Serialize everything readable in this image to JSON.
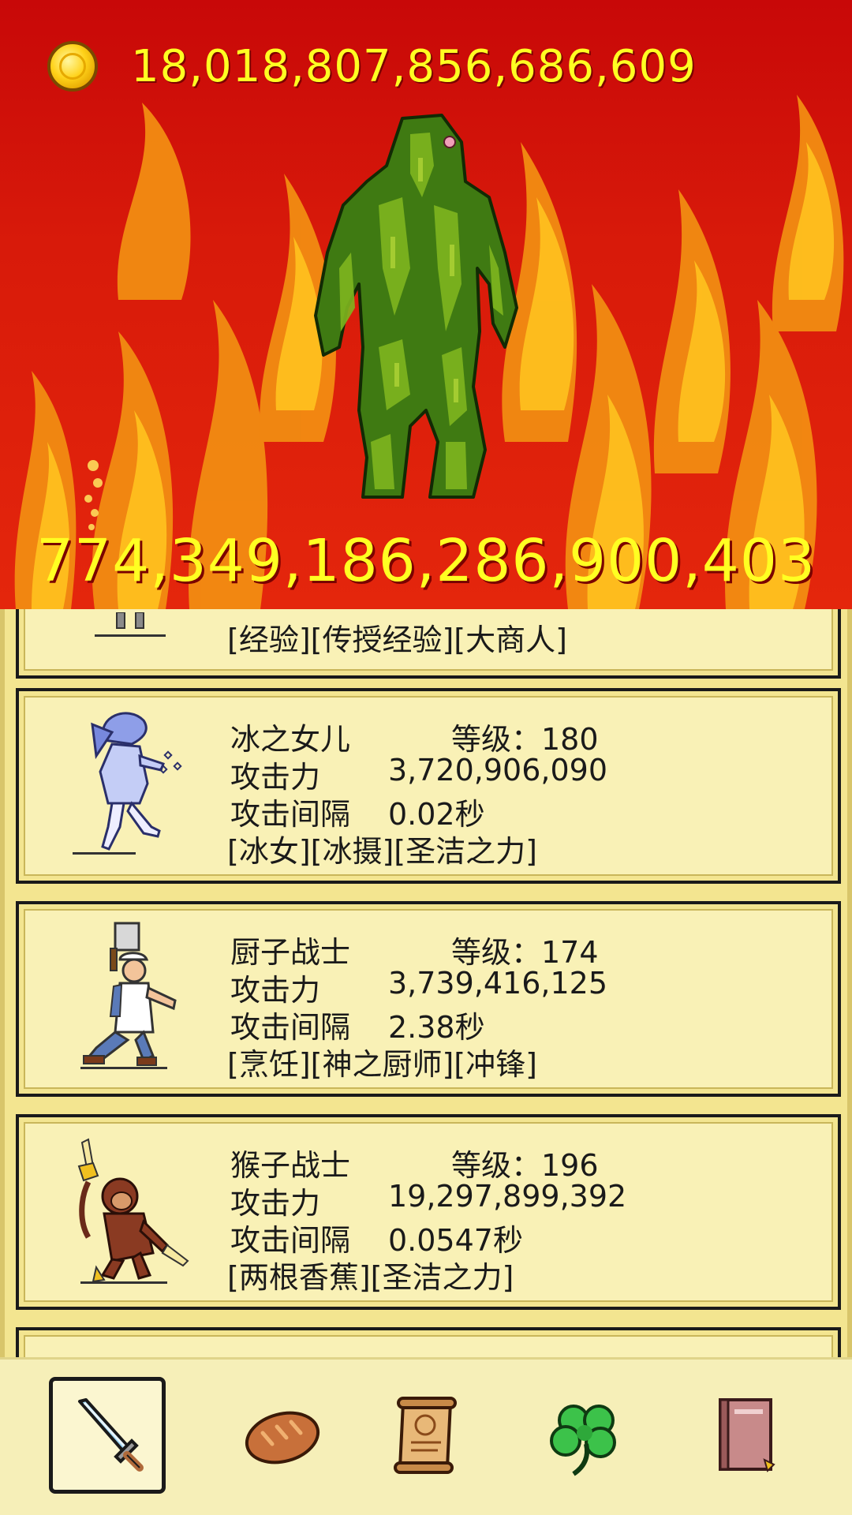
{
  "header": {
    "gold_icon": "gold-coin-icon",
    "gold_amount": "18,018,807,856,686,609"
  },
  "battle": {
    "monster_icon": "green-tree-golem",
    "monster_hp": "774,349,186,286,900,403"
  },
  "heroes": {
    "partial_tags": "[经验][传授经验][大商人]",
    "items": [
      {
        "portrait_icon": "ice-daughter-portrait",
        "name": "冰之女儿",
        "level": "等级：180",
        "atk_label": "攻击力",
        "atk_value": "3,720,906,090",
        "interval_label": "攻击间隔",
        "interval_value": "0.02秒",
        "tags": "[冰女][冰摄][圣洁之力]"
      },
      {
        "portrait_icon": "chef-warrior-portrait",
        "name": "厨子战士",
        "level": "等级：174",
        "atk_label": "攻击力",
        "atk_value": "3,739,416,125",
        "interval_label": "攻击间隔",
        "interval_value": "2.38秒",
        "tags": "[烹饪][神之厨师][冲锋]"
      },
      {
        "portrait_icon": "monkey-warrior-portrait",
        "name": "猴子战士",
        "level": "等级：196",
        "atk_label": "攻击力",
        "atk_value": "19,297,899,392",
        "interval_label": "攻击间隔",
        "interval_value": "0.0547秒",
        "tags": "[两根香蕉][圣洁之力]"
      }
    ]
  },
  "nav": {
    "tabs": [
      {
        "icon": "sword-icon",
        "active": true
      },
      {
        "icon": "bread-icon",
        "active": false
      },
      {
        "icon": "scroll-icon",
        "active": false
      },
      {
        "icon": "clover-icon",
        "active": false
      },
      {
        "icon": "book-icon",
        "active": false
      }
    ]
  },
  "colors": {
    "scene_red": "#c80808",
    "gold_text": "#ffff22",
    "card_bg": "#f9f1b6",
    "panel_bg": "#f3e590"
  }
}
